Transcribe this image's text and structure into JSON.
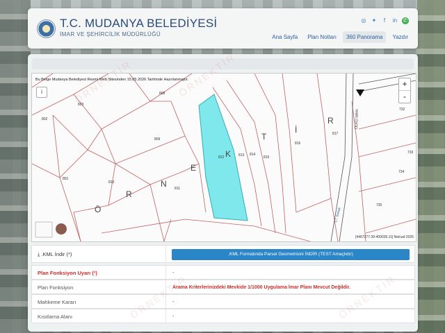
{
  "header": {
    "title": "T.C. MUDANYA BELEDİYESİ",
    "subtitle": "İMAR VE ŞEHİRCİLİK MÜDÜRLÜĞÜ",
    "social_icons": [
      "instagram-icon",
      "twitter-icon",
      "facebook-icon",
      "linkedin-icon",
      "whatsapp-icon"
    ],
    "nav": [
      {
        "label": "Ana Sayfa",
        "active": false
      },
      {
        "label": "Plan Notları",
        "active": false
      },
      {
        "label": "360 Panorama",
        "active": true
      },
      {
        "label": "Yazdır",
        "active": false
      }
    ]
  },
  "map": {
    "note": "Bu Belge Mudanya Belediyesi Resmi Web Sitesinden 15.05.2026 Tarihinde Hazırlanmıştır.",
    "info_label": "i",
    "zoom_in": "+",
    "zoom_out": "-",
    "coordinates": "[4467277.39-409035.11] Netcad 2026",
    "north_label": "",
    "big_labels": [
      "Ö",
      "R",
      "N",
      "E",
      "K",
      "T",
      "İ",
      "R"
    ],
    "parcel_labels": [
      "803",
      "808",
      "802",
      "809",
      "801",
      "810",
      "811",
      "812",
      "813",
      "814",
      "815",
      "816",
      "817",
      "732",
      "733",
      "734",
      "735"
    ],
    "street_labels": [
      "ÜLKÜ MAH.",
      "17. Sokak"
    ],
    "highlight_color": "#7fe8ec"
  },
  "rows": {
    "kml_label": ".KML İndir (*)",
    "kml_button": ".KML Formatında Parsel Geometrisini İNDİR (TEST Amaçlıdır)",
    "plan_fonk_uyari_label": "Plan Fonksiyon Uyarı (²)",
    "plan_fonk_uyari_value": "-",
    "plan_fonk_label": "Plan Fonksiyon",
    "plan_fonk_value": "Arama Kriterlerinizdeki Mevkide 1/1000 Uygulama İmar Planı Mevcut Değildir.",
    "mahkeme_label": "Mahkeme Kararı",
    "mahkeme_value": "-",
    "kisitlama_label": "Kısıtlama Alanı",
    "kisitlama_value": "-"
  },
  "watermark": "ÖRNEKTİR"
}
